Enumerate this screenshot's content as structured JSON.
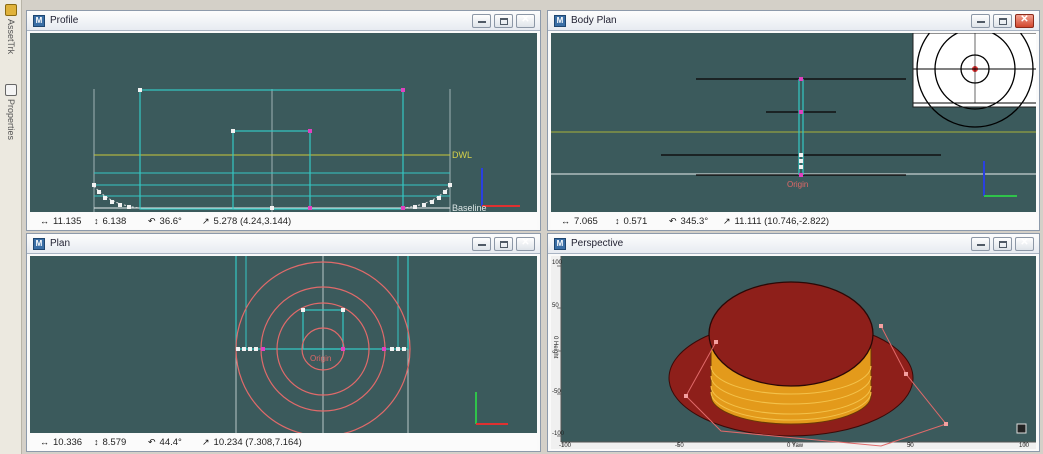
{
  "sidebar": {
    "tabs": [
      {
        "label": "AssetTrk",
        "icon": "asset-tracker-icon"
      },
      {
        "label": "Properties",
        "icon": "properties-icon"
      }
    ]
  },
  "windows": {
    "profile": {
      "title": "Profile",
      "status": {
        "width": "11.135",
        "height": "6.138",
        "angle": "36.6°",
        "distance": "5.278 (4.24,3.144)"
      },
      "labels": {
        "dwl": "DWL",
        "baseline": "Baseline"
      }
    },
    "body_plan": {
      "title": "Body Plan",
      "status": {
        "width": "7.065",
        "height": "0.571",
        "angle": "345.3°",
        "distance": "11.111 (10.746,-2.822)"
      },
      "labels": {
        "origin": "Origin"
      }
    },
    "plan": {
      "title": "Plan",
      "status": {
        "width": "10.336",
        "height": "8.579",
        "angle": "44.4°",
        "distance": "10.234 (7.308,7.164)"
      },
      "labels": {
        "origin": "Origin"
      }
    },
    "perspective": {
      "title": "Perspective",
      "ruler": {
        "left_ticks": [
          "100",
          "50",
          "0 Height",
          "-50",
          "-100"
        ],
        "bottom_ticks": [
          "-100",
          "-50",
          "0 Yaw",
          "50",
          "100"
        ]
      }
    }
  },
  "colors": {
    "viewport_bg": "#3b5a5c",
    "geometry_teal": "#34c7c4",
    "dwl_yellow": "#c8c83a",
    "baseline_white": "#e8eeee",
    "hull_red": "#8e1f1a",
    "hull_orange": "#e39a1b",
    "section_black": "#111111"
  }
}
